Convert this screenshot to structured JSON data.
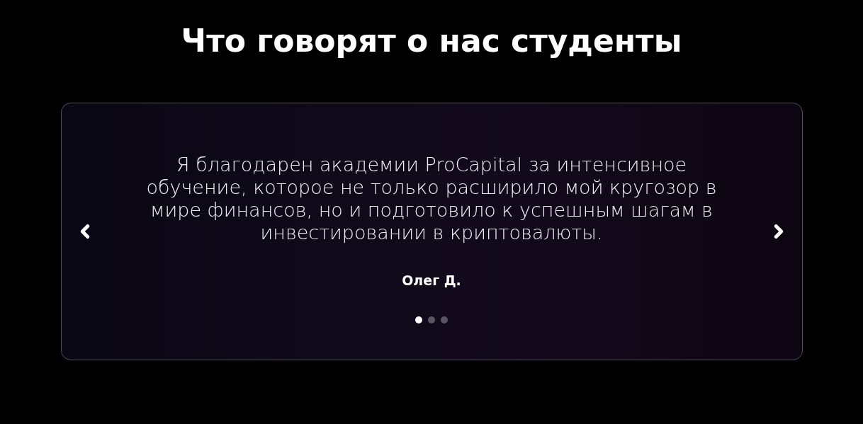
{
  "heading": "Что говорят о нас студенты",
  "testimonial": {
    "text": "Я благодарен академии ProCapital за интенсивное обучение, которое не только расширило мой кругозор в мире финансов, но и подготовило к успешным шагам в инвестировании в криптовалюты.",
    "author": "Олег Д."
  },
  "dots": [
    {
      "selected": true
    },
    {
      "selected": false
    },
    {
      "selected": false
    }
  ]
}
